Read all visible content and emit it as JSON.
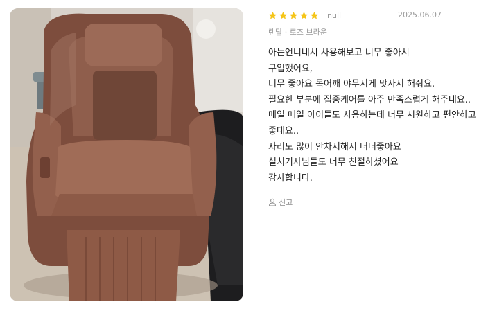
{
  "review": {
    "rating": 5,
    "max_rating": 5,
    "star_color": "#f5c518",
    "author": "null",
    "date": "2025.06.07",
    "option": "렌탈 · 로즈 브라운",
    "lines": [
      "아는언니네서 사용해보고 너무 좋아서",
      "구입했어요,",
      "너무 좋아요 목어깨 야무지게 맛사지 해줘요.",
      "필요한 부분에 집중케어를 아주 만족스럽게 해주네요..",
      "매일 매일 아이들도 사용하는데 너무 시원하고 편안하고",
      "좋대요..",
      "자리도 많이 안차지해서 더더좋아요",
      "설치기사님들도 너무 친절하셨어요",
      "감사합니다."
    ],
    "report_label": "신고",
    "report_icon": "user-report-icon",
    "photo": {
      "subject_color": "#8b5a48"
    }
  }
}
